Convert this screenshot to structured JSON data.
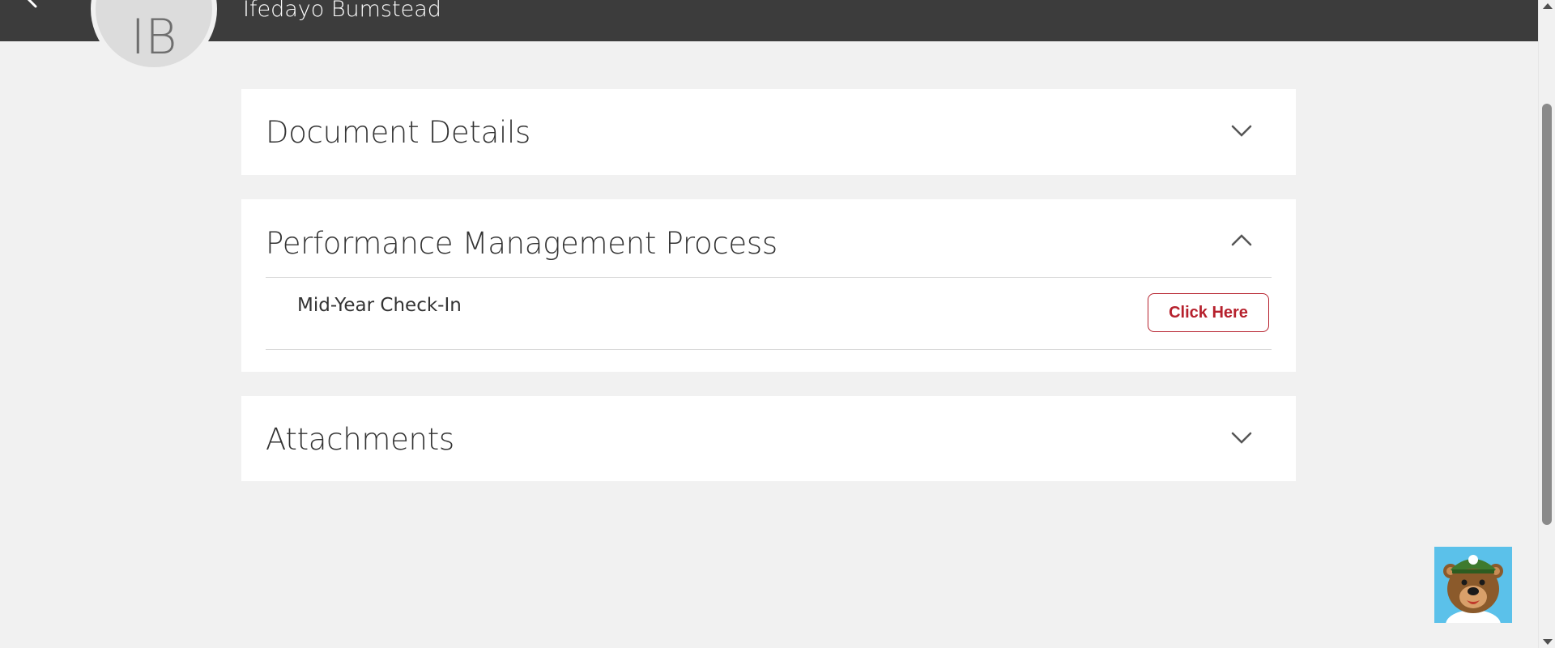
{
  "header": {
    "avatar_initials": "IB",
    "user_name": "Ifedayo Bumstead",
    "background_color": "#3c3c3c"
  },
  "sections": {
    "document_details": {
      "title": "Document Details",
      "expanded": false
    },
    "performance_management": {
      "title": "Performance Management Process",
      "expanded": true,
      "items": [
        {
          "label": "Mid-Year Check-In",
          "action_label": "Click Here"
        }
      ]
    },
    "attachments": {
      "title": "Attachments",
      "expanded": false
    }
  },
  "icons": {
    "back": "chevron-left-icon",
    "collapsed": "chevron-down-icon",
    "expanded": "chevron-up-icon",
    "assistant": "bear-mascot-icon"
  },
  "colors": {
    "accent": "#b6212d",
    "page_background": "#f1f1f1",
    "card_background": "#ffffff",
    "mascot_background": "#5bc1ea"
  }
}
